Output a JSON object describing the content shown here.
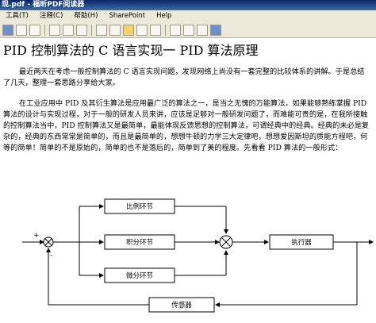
{
  "window": {
    "title": "现.pdf - 福昕PDF阅读器"
  },
  "menu": {
    "items": [
      "工具(T)",
      "注释(C)",
      "帮助(H)",
      "SharePoint",
      "Help"
    ]
  },
  "document": {
    "title": "PID 控制算法的 C 语言实现一 PID 算法原理",
    "paragraph1": "最近两天在考虑一般控制算法的 C 语言实现问题，发现网络上尚没有一套完整的比较体系的讲解。于是总结了几天，整理一套思路分享给大家。",
    "paragraph2": "在工业应用中 PID 及其衍生算法是应用最广泛的算法之一，是当之无愧的万能算法，如果能够熟练掌握 PID 算法的设计与实现过程，对于一般的研发人员来讲，应该是足够对一般研发问题了，而难能可贵的是，在我所接触的控制算法当中，PID 控制算法又是最简单，最能体现反馈思想的控制算法，可谓经典中的经典。经典的未必是复杂的，经典的东西常常是简单的，而且是最简单的，想想牛顿的力学三大定律吧，想想爱因斯坦的质能方程吧，何等的简单！简单的不是原始的，简单的也不是落后的，简单到了美的程度。先看看 PID 算法的一般形式："
  },
  "diagram": {
    "blocks": {
      "p": "比例环节",
      "i": "积分环节",
      "d": "微分环节",
      "actuator": "执行器",
      "sensor": "传感器"
    },
    "plus": "+",
    "minus": "-"
  }
}
